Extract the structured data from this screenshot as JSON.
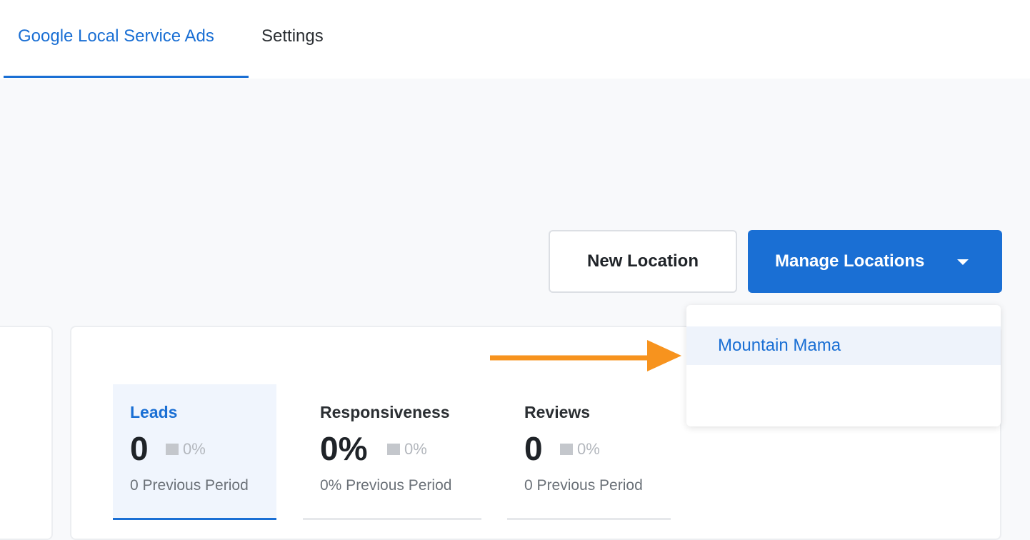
{
  "tabs": [
    {
      "label": "Google Local Service Ads",
      "active": true
    },
    {
      "label": "Settings",
      "active": false
    }
  ],
  "actions": {
    "new_location_label": "New Location",
    "manage_locations_label": "Manage Locations"
  },
  "dropdown": {
    "items": [
      "Mountain Mama"
    ]
  },
  "stats": [
    {
      "title": "Leads",
      "value": "0",
      "change": "0%",
      "previous": "0 Previous Period",
      "selected": true
    },
    {
      "title": "Responsiveness",
      "value": "0%",
      "change": "0%",
      "previous": "0% Previous Period",
      "selected": false
    },
    {
      "title": "Reviews",
      "value": "0",
      "change": "0%",
      "previous": "0 Previous Period",
      "selected": false
    }
  ],
  "colors": {
    "accent": "#1a6fd4",
    "arrow": "#f7931e",
    "background": "#f8f9fb"
  },
  "icons": {
    "dropdown_caret": "caret-down-icon",
    "annotation_arrow": "arrow-right-icon",
    "change_indicator": "neutral-square-icon"
  }
}
